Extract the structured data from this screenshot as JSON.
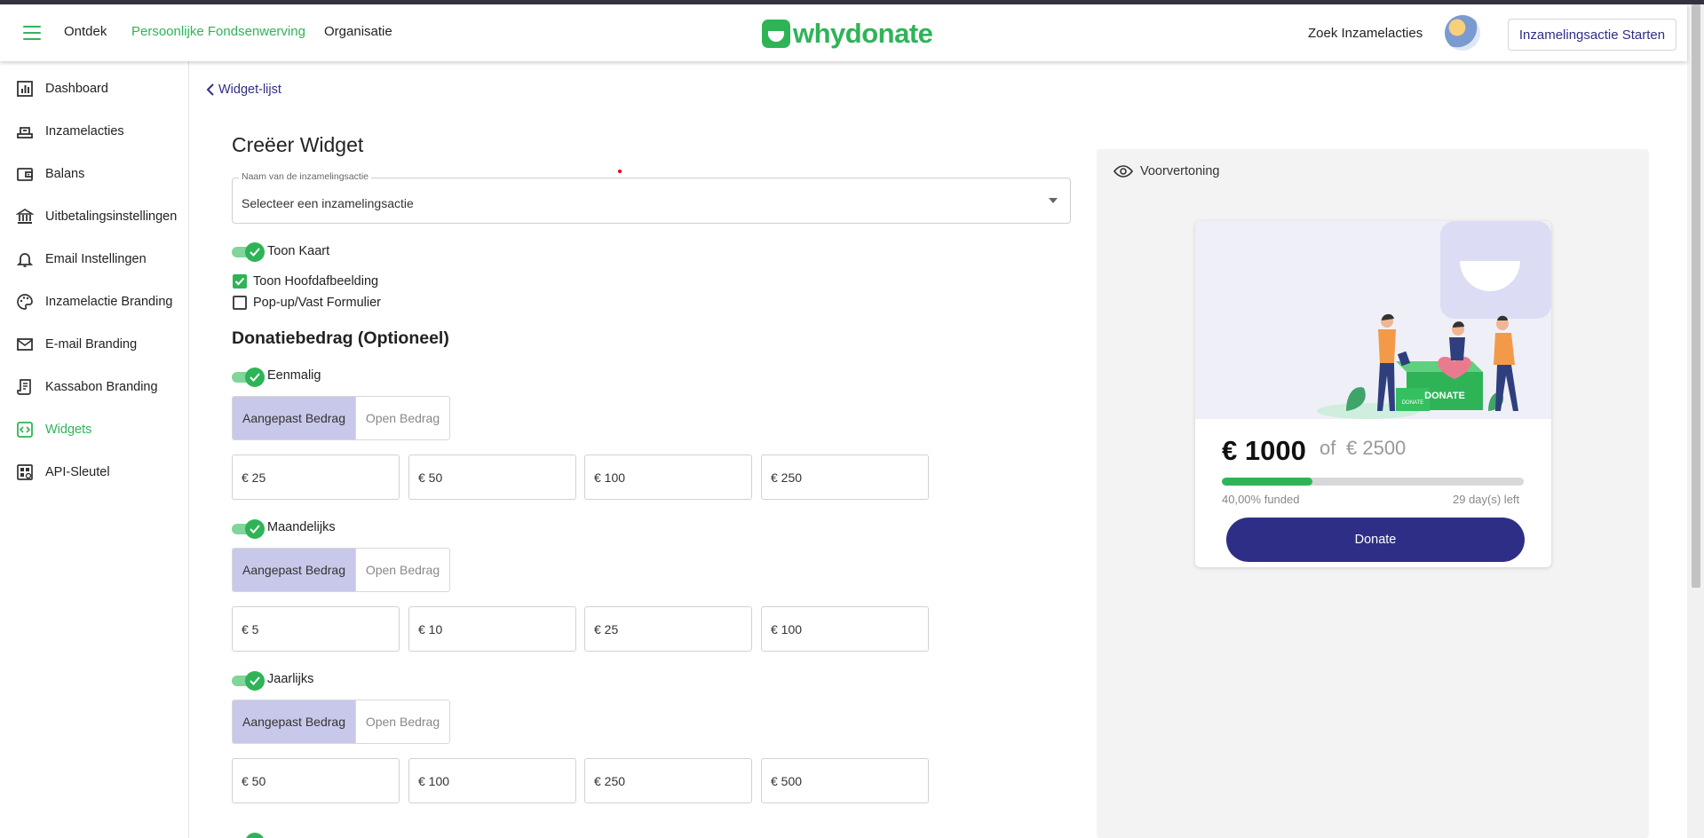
{
  "header": {
    "nav": [
      "Ontdek",
      "Persoonlijke Fondsenwerving",
      "Organisatie"
    ],
    "logo_text": "whydonate",
    "search_link": "Zoek Inzamelacties",
    "start_button": "Inzamelingsactie Starten",
    "brand_color": "#2eb457",
    "accent_color": "#2f2e86"
  },
  "sidebar": {
    "items": [
      {
        "label": "Dashboard",
        "icon": "bar-chart-icon"
      },
      {
        "label": "Inzamelacties",
        "icon": "fundraiser-icon"
      },
      {
        "label": "Balans",
        "icon": "wallet-icon"
      },
      {
        "label": "Uitbetalingsinstellingen",
        "icon": "bank-icon"
      },
      {
        "label": "Email Instellingen",
        "icon": "bell-icon"
      },
      {
        "label": "Inzamelactie Branding",
        "icon": "palette-icon"
      },
      {
        "label": "E-mail Branding",
        "icon": "envelope-icon"
      },
      {
        "label": "Kassabon Branding",
        "icon": "receipt-icon"
      },
      {
        "label": "Widgets",
        "icon": "code-icon",
        "active": true
      },
      {
        "label": "API-Sleutel",
        "icon": "api-key-icon"
      }
    ]
  },
  "main": {
    "back_link": "Widget-lijst",
    "title": "Creëer Widget",
    "fundraiser_select": {
      "label": "Naam van de inzamelingsactie",
      "value": "Selecteer een inzamelingsactie"
    },
    "show_card_toggle": {
      "label": "Toon Kaart",
      "on": true
    },
    "show_image_checkbox": {
      "label": "Toon Hoofdafbeelding",
      "checked": true
    },
    "popup_checkbox": {
      "label": "Pop-up/Vast Formulier",
      "checked": false
    },
    "donation_heading": "Donatiebedrag (Optioneel)",
    "segment": {
      "custom": "Aangepast Bedrag",
      "open": "Open Bedrag"
    },
    "frequencies": [
      {
        "label": "Eenmalig",
        "on": true,
        "amounts": [
          "€ 25",
          "€ 50",
          "€ 100",
          "€ 250"
        ]
      },
      {
        "label": "Maandelijks",
        "on": true,
        "amounts": [
          "€ 5",
          "€ 10",
          "€ 25",
          "€ 100"
        ]
      },
      {
        "label": "Jaarlijks",
        "on": true,
        "amounts": [
          "€ 50",
          "€ 100",
          "€ 250",
          "€ 500"
        ]
      }
    ]
  },
  "preview": {
    "label": "Voorvertoning",
    "raised": "€ 1000",
    "of": "of",
    "goal": "€ 2500",
    "progress_fraction": 0.3,
    "funded_text": "40,00% funded",
    "days_left": "29 day(s) left",
    "donate_button": "Donate",
    "box_label": "DONATE",
    "small_box_label": "DONATE"
  }
}
